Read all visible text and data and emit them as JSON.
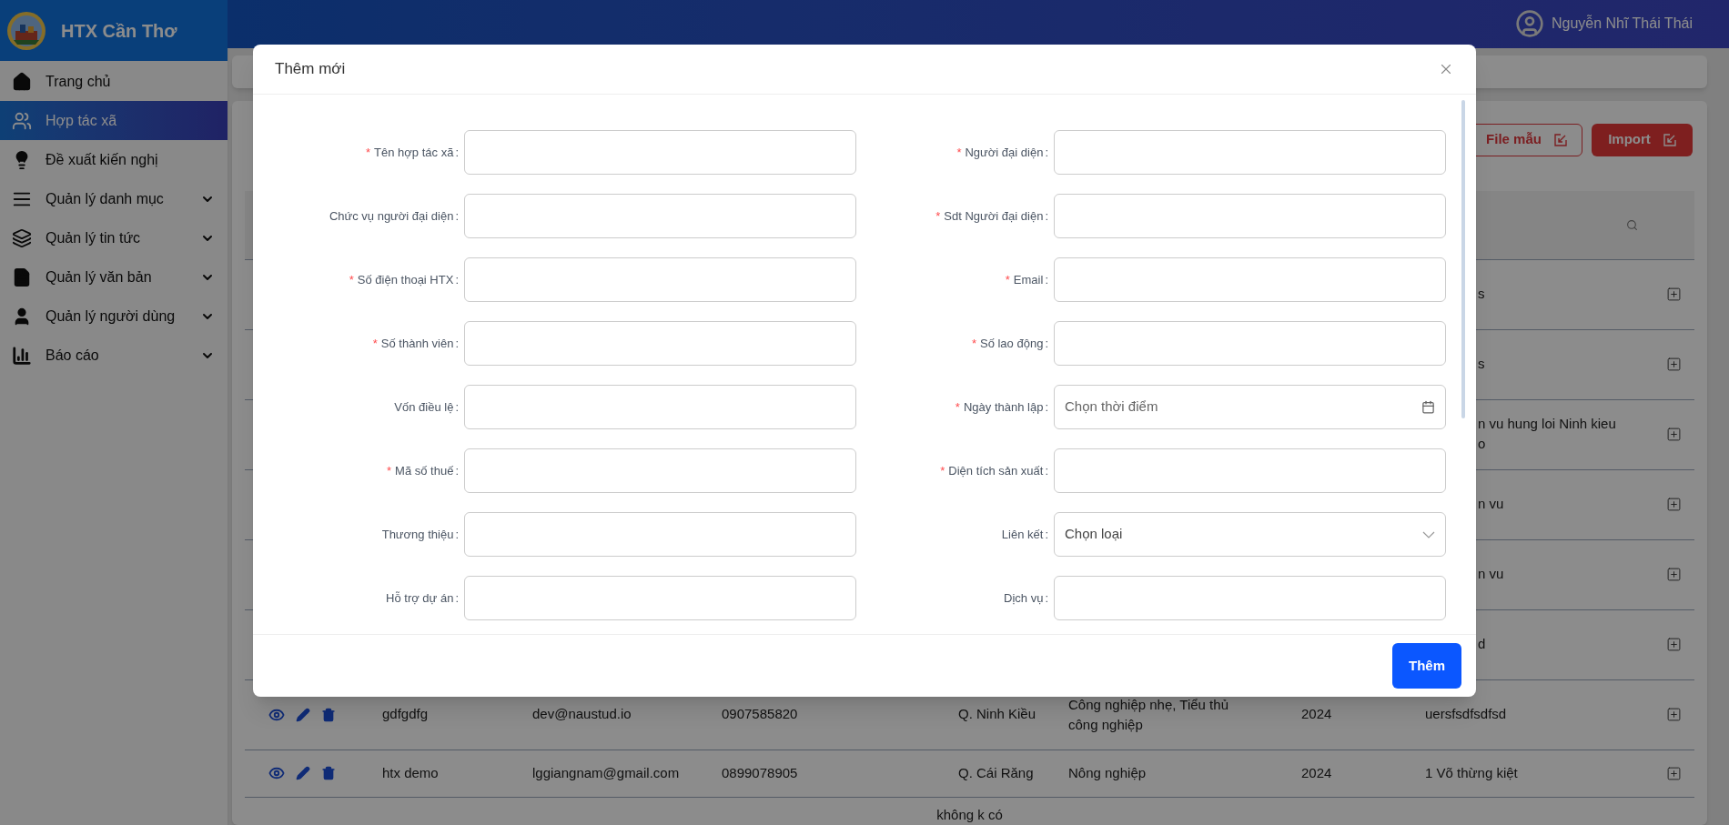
{
  "sidebar": {
    "title": "HTX Cần Thơ",
    "items": [
      {
        "label": "Trang chủ",
        "kind": "home",
        "selected": false,
        "expandable": false
      },
      {
        "label": "Hợp tác xã",
        "kind": "users",
        "selected": true,
        "expandable": false
      },
      {
        "label": "Đề xuất kiến nghị",
        "kind": "bulb",
        "selected": false,
        "expandable": false
      },
      {
        "label": "Quản lý danh mục",
        "kind": "list",
        "selected": false,
        "expandable": true
      },
      {
        "label": "Quản lý tin tức",
        "kind": "layers",
        "selected": false,
        "expandable": true
      },
      {
        "label": "Quản lý văn bản",
        "kind": "document",
        "selected": false,
        "expandable": true
      },
      {
        "label": "Quản lý người dùng",
        "kind": "user",
        "selected": false,
        "expandable": true
      },
      {
        "label": "Báo cáo",
        "kind": "chart",
        "selected": false,
        "expandable": true
      }
    ]
  },
  "user": {
    "name": "Nguyễn Nhĩ Thái Thái"
  },
  "toolbar": {
    "buttons": [
      {
        "label": "File mẫu",
        "kind": "outline"
      },
      {
        "label": "Import",
        "kind": "solid"
      }
    ]
  },
  "table": {
    "rows": [
      {
        "kind": "covered",
        "address": "s"
      },
      {
        "kind": "covered",
        "address": "s"
      },
      {
        "kind": "covered",
        "address": "n vu hung loi Ninh kieu\no"
      },
      {
        "kind": "covered",
        "address": "n vu"
      },
      {
        "kind": "covered",
        "address": "n vu"
      },
      {
        "kind": "covered",
        "address": "d"
      },
      {
        "kind": "full",
        "name": "gdfgdfg",
        "email": "dev@naustud.io",
        "phone": "0907585820",
        "district": "Q. Ninh Kiều",
        "sector": "Công nghiệp nhẹ, Tiểu thủ công nghiệp",
        "year": "2024",
        "address": "uersfsdfsdfsd"
      },
      {
        "kind": "full",
        "name": "htx demo",
        "email": "lggiangnam@gmail.com",
        "phone": "0899078905",
        "district": "Q. Cái Răng",
        "sector": "Nông nghiệp",
        "year": "2024",
        "address": "1 Võ thừng kiệt"
      }
    ],
    "note": "không k có"
  },
  "modal": {
    "title": "Thêm mới",
    "submit": "Thêm",
    "required_mark": "*",
    "colon": ":",
    "fields": [
      [
        {
          "label": "Tên hợp tác xã",
          "required": true,
          "kind": "text"
        },
        {
          "label": "Người đại diện",
          "required": true,
          "kind": "text"
        }
      ],
      [
        {
          "label": "Chức vụ người đại diện",
          "required": false,
          "kind": "text"
        },
        {
          "label": "Sdt Người đại diện",
          "required": true,
          "kind": "text"
        }
      ],
      [
        {
          "label": "Số điện thoại HTX",
          "required": true,
          "kind": "text"
        },
        {
          "label": "Email",
          "required": true,
          "kind": "text"
        }
      ],
      [
        {
          "label": "Số thành viên",
          "required": true,
          "kind": "text"
        },
        {
          "label": "Số lao động",
          "required": true,
          "kind": "text"
        }
      ],
      [
        {
          "label": "Vốn điều lệ",
          "required": false,
          "kind": "text"
        },
        {
          "label": "Ngày thành lập",
          "required": true,
          "kind": "date",
          "placeholder": "Chọn thời điểm"
        }
      ],
      [
        {
          "label": "Mã số thuế",
          "required": true,
          "kind": "text"
        },
        {
          "label": "Diện tích sản xuất",
          "required": true,
          "kind": "text"
        }
      ],
      [
        {
          "label": "Thương thiệu",
          "required": false,
          "kind": "text"
        },
        {
          "label": "Liên kết",
          "required": false,
          "kind": "select",
          "placeholder": "Chọn loại"
        }
      ],
      [
        {
          "label": "Hỗ trợ dự án",
          "required": false,
          "kind": "text"
        },
        {
          "label": "Dịch vụ",
          "required": false,
          "kind": "text"
        }
      ]
    ]
  }
}
